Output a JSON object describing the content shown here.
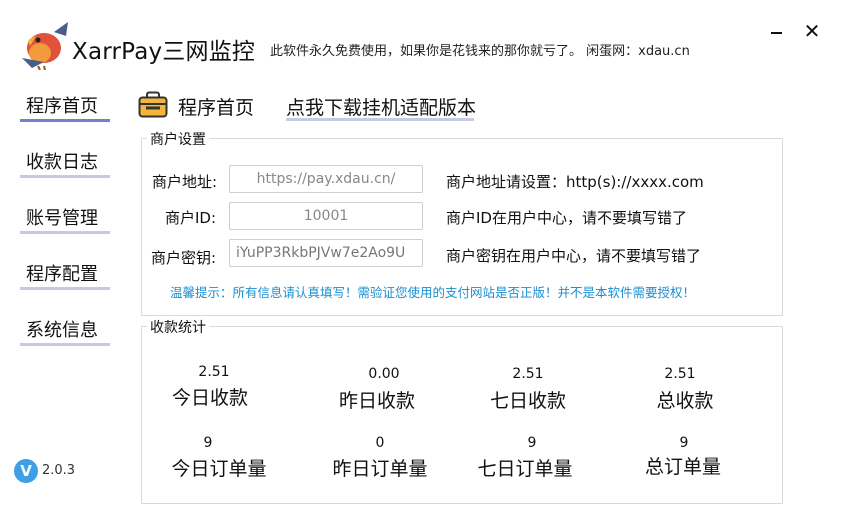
{
  "header": {
    "app_title": "XarrPay三网监控",
    "tagline": "此软件永久免费使用，如果你是花钱来的那你就亏了。 闲蛋网：xdau.cn",
    "minimize_label": "",
    "close_label": "✕"
  },
  "sidebar": {
    "items": [
      {
        "label": "程序首页",
        "active": true
      },
      {
        "label": "收款日志",
        "active": false
      },
      {
        "label": "账号管理",
        "active": false
      },
      {
        "label": "程序配置",
        "active": false
      },
      {
        "label": "系统信息",
        "active": false
      }
    ],
    "version": "2.0.3",
    "version_badge": "V"
  },
  "content": {
    "title": "程序首页",
    "download_link": "点我下载挂机适配版本"
  },
  "merchant": {
    "legend": "商户设置",
    "address_label": "商户地址:",
    "address_value": "https://pay.xdau.cn/",
    "address_hint": "商户地址请设置：http(s)://xxxx.com",
    "id_label": "商户ID:",
    "id_value": "10001",
    "id_hint": "商户ID在用户中心，请不要填写错了",
    "key_label": "商户密钥:",
    "key_value": "iYuPP3RkbPJVw7e2Ao9U",
    "key_hint": "商户密钥在用户中心，请不要填写错了",
    "tip": "温馨提示：所有信息请认真填写！需验证您使用的支付网站是否正版！并不是本软件需要授权！"
  },
  "stats": {
    "legend": "收款统计",
    "today_amount": "2.51",
    "today_amount_label": "今日收款",
    "yesterday_amount": "0.00",
    "yesterday_amount_label": "昨日收款",
    "week_amount": "2.51",
    "week_amount_label": "七日收款",
    "total_amount": "2.51",
    "total_amount_label": "总收款",
    "today_orders": "9",
    "today_orders_label": "今日订单量",
    "yesterday_orders": "0",
    "yesterday_orders_label": "昨日订单量",
    "week_orders": "9",
    "week_orders_label": "七日订单量",
    "total_orders": "9",
    "total_orders_label": "总订单量"
  },
  "colors": {
    "accent": "#7281c8",
    "nav_underline": "#c5cbe6",
    "tip": "#1a8fd1",
    "version_badge": "#3d9fe6"
  },
  "icons": {
    "logo": "bird-logo",
    "home": "briefcase-icon",
    "version": "v-badge-icon"
  }
}
